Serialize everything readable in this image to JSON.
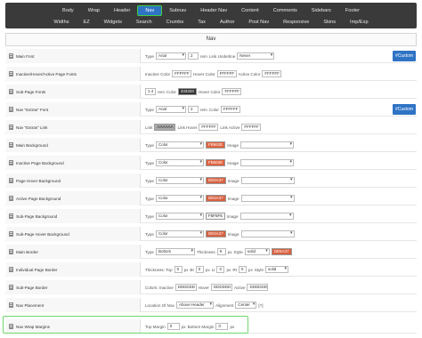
{
  "nav_row1": [
    "Body",
    "Wrap",
    "Header",
    "Nav",
    "Subnav",
    "Header Nav",
    "Content",
    "Comments",
    "Sidebars",
    "Footer"
  ],
  "nav_row2": [
    "Widths",
    "EZ",
    "Widgets",
    "Search",
    "Crumbs",
    "Tax",
    "Author",
    "Post Nav",
    "Responsive",
    "Skins",
    "Imp/Exp"
  ],
  "active_tab": "Nav",
  "section_title": "Nav",
  "custom_label": "#Custom",
  "colors": {
    "accent": "#2f73c4",
    "highlight": "#6fd66f",
    "swatch_red": "#d9603f"
  },
  "rows": [
    {
      "label": "Main Font",
      "custom": true,
      "controls": [
        {
          "k": "t",
          "v": "Type"
        },
        {
          "k": "sel",
          "v": "Arial",
          "w": 34
        },
        {
          "k": "inp",
          "v": "2",
          "w": 12
        },
        {
          "k": "t",
          "v": "rem"
        },
        {
          "k": "t",
          "v": "Link Underline"
        },
        {
          "k": "sel",
          "v": "Never",
          "w": 42
        }
      ]
    },
    {
      "label": "Inactive/Hover/Active Page Fonts",
      "controls": [
        {
          "k": "t",
          "v": "Inactive Color"
        },
        {
          "k": "inp",
          "v": "FFFFFF",
          "w": 22
        },
        {
          "k": "t",
          "v": "Hover Color"
        },
        {
          "k": "inp",
          "v": "FFFFFF",
          "w": 22
        },
        {
          "k": "t",
          "v": "Active Color"
        },
        {
          "k": "inp",
          "v": "FFFFFF",
          "w": 22
        }
      ]
    },
    {
      "label": "Sub-Page Fonts",
      "controls": [
        {
          "k": "inp",
          "v": "1.4",
          "w": 12
        },
        {
          "k": "t",
          "v": "rem"
        },
        {
          "k": "t",
          "v": "Color"
        },
        {
          "k": "sw",
          "v": "333333",
          "bg": "#333333",
          "fg": "#ffffff"
        },
        {
          "k": "t",
          "v": "Hover Color"
        },
        {
          "k": "inp",
          "v": "FFFFFF",
          "w": 22
        }
      ]
    },
    {
      "label": "Nav \"Extras\" Font",
      "custom": true,
      "controls": [
        {
          "k": "t",
          "v": "Type"
        },
        {
          "k": "sel",
          "v": "Arial",
          "w": 34
        },
        {
          "k": "inp",
          "v": "2",
          "w": 12
        },
        {
          "k": "t",
          "v": "rem"
        },
        {
          "k": "t",
          "v": "Color"
        },
        {
          "k": "inp",
          "v": "FFFFFF",
          "w": 22
        }
      ]
    },
    {
      "label": "Nav \"Extras\" Link",
      "controls": [
        {
          "k": "t",
          "v": "Link"
        },
        {
          "k": "sw",
          "v": "AAAAAA",
          "bg": "#aaaaaa",
          "fg": "#222222"
        },
        {
          "k": "t",
          "v": "Link Hover"
        },
        {
          "k": "inp",
          "v": "FFFFFF",
          "w": 22
        },
        {
          "k": "t",
          "v": "Link Active"
        },
        {
          "k": "inp",
          "v": "FFFFFF",
          "w": 22
        }
      ]
    },
    {
      "label": "Main Background",
      "controls": [
        {
          "k": "t",
          "v": "Type"
        },
        {
          "k": "sel",
          "v": "Color",
          "w": 54
        },
        {
          "k": "sw",
          "v": "FB663E",
          "bg": "#e0633f",
          "fg": "#ffffff"
        },
        {
          "k": "t",
          "v": "Image"
        },
        {
          "k": "sel",
          "v": "",
          "w": 60
        }
      ]
    },
    {
      "label": "Inactive Page Background",
      "controls": [
        {
          "k": "t",
          "v": "Type"
        },
        {
          "k": "sel",
          "v": "Color",
          "w": 54
        },
        {
          "k": "sw",
          "v": "FB663E",
          "bg": "#e0633f",
          "fg": "#ffffff"
        },
        {
          "k": "t",
          "v": "Image"
        },
        {
          "k": "sel",
          "v": "",
          "w": 60
        }
      ]
    },
    {
      "label": "Page Hover Background",
      "controls": [
        {
          "k": "t",
          "v": "Type"
        },
        {
          "k": "sel",
          "v": "Color",
          "w": 54
        },
        {
          "k": "sw",
          "v": "DE5A37",
          "bg": "#d9603f",
          "fg": "#ffffff"
        },
        {
          "k": "t",
          "v": "Image"
        },
        {
          "k": "sel",
          "v": "",
          "w": 60
        }
      ]
    },
    {
      "label": "Active Page Background",
      "controls": [
        {
          "k": "t",
          "v": "Type"
        },
        {
          "k": "sel",
          "v": "Color",
          "w": 54
        },
        {
          "k": "sw",
          "v": "DE5A37",
          "bg": "#d9603f",
          "fg": "#ffffff"
        },
        {
          "k": "t",
          "v": "Image"
        },
        {
          "k": "sel",
          "v": "",
          "w": 60
        }
      ]
    },
    {
      "label": "Sub-Page Background",
      "controls": [
        {
          "k": "t",
          "v": "Type"
        },
        {
          "k": "sel",
          "v": "Color",
          "w": 54
        },
        {
          "k": "sw",
          "v": "F5F5F5",
          "bg": "#f5f5f5",
          "fg": "#333333"
        },
        {
          "k": "t",
          "v": "Image"
        },
        {
          "k": "sel",
          "v": "",
          "w": 60
        }
      ]
    },
    {
      "label": "Sub-Page Hover Background",
      "controls": [
        {
          "k": "t",
          "v": "Type"
        },
        {
          "k": "sel",
          "v": "Color",
          "w": 54
        },
        {
          "k": "sw",
          "v": "DE5A37",
          "bg": "#d9603f",
          "fg": "#ffffff"
        },
        {
          "k": "t",
          "v": "Image"
        },
        {
          "k": "sel",
          "v": "",
          "w": 60
        }
      ]
    },
    {
      "label": "Main Border",
      "controls": [
        {
          "k": "t",
          "v": "Type"
        },
        {
          "k": "sel",
          "v": "Bottom",
          "w": 44
        },
        {
          "k": "t",
          "v": "Thickness"
        },
        {
          "k": "inp",
          "v": "9",
          "w": 10
        },
        {
          "k": "t",
          "v": "px"
        },
        {
          "k": "t",
          "v": "Style"
        },
        {
          "k": "sel",
          "v": "solid",
          "w": 28
        },
        {
          "k": "sw",
          "v": "DE5A37",
          "bg": "#d9603f",
          "fg": "#ffffff"
        }
      ]
    },
    {
      "label": "Individual Page Border",
      "controls": [
        {
          "k": "t",
          "v": "Thickness: Top"
        },
        {
          "k": "inp",
          "v": "0",
          "w": 9
        },
        {
          "k": "t",
          "v": "px"
        },
        {
          "k": "t",
          "v": "Bt"
        },
        {
          "k": "inp",
          "v": "0",
          "w": 9
        },
        {
          "k": "t",
          "v": "px"
        },
        {
          "k": "t",
          "v": "Lt"
        },
        {
          "k": "inp",
          "v": "0",
          "w": 9
        },
        {
          "k": "t",
          "v": "px"
        },
        {
          "k": "t",
          "v": "Rt"
        },
        {
          "k": "inp",
          "v": "0",
          "w": 9
        },
        {
          "k": "t",
          "v": "px"
        },
        {
          "k": "t",
          "v": "Style"
        },
        {
          "k": "sel",
          "v": "solid",
          "w": 26
        }
      ]
    },
    {
      "label": "Sub-Page Border",
      "controls": [
        {
          "k": "t",
          "v": "Colors: Inactive"
        },
        {
          "k": "inp",
          "v": "DDDDDD",
          "w": 24
        },
        {
          "k": "t",
          "v": "Hover"
        },
        {
          "k": "inp",
          "v": "DDDDDD",
          "w": 24
        },
        {
          "k": "t",
          "v": "Active"
        },
        {
          "k": "inp",
          "v": "DDDDDD",
          "w": 24
        }
      ]
    },
    {
      "label": "Nav Placement",
      "controls": [
        {
          "k": "t",
          "v": "Location Of Nav"
        },
        {
          "k": "sel",
          "v": "Above Header",
          "w": 42
        },
        {
          "k": "t",
          "v": "Alignment"
        },
        {
          "k": "sel",
          "v": "Center",
          "w": 24
        },
        {
          "k": "t",
          "v": "[?]"
        }
      ]
    },
    {
      "label": "Nav Wrap Margins",
      "controls": [
        {
          "k": "t",
          "v": "Top Margin"
        },
        {
          "k": "inp",
          "v": "0",
          "w": 14
        },
        {
          "k": "t",
          "v": "px"
        },
        {
          "k": "t",
          "v": "Bottom Margin"
        },
        {
          "k": "inp",
          "v": "0",
          "w": 14
        },
        {
          "k": "t",
          "v": "px"
        }
      ]
    }
  ]
}
